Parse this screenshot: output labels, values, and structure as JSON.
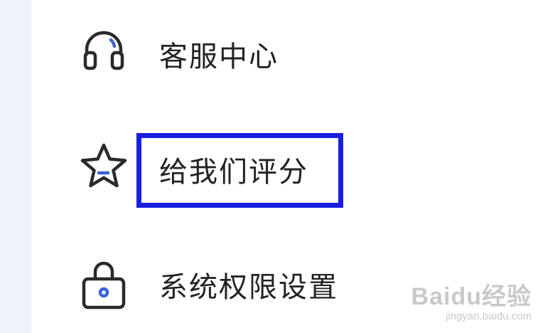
{
  "menu": {
    "items": [
      {
        "label": "客服中心",
        "icon": "headset-icon"
      },
      {
        "label": "给我们评分",
        "icon": "star-icon"
      },
      {
        "label": "系统权限设置",
        "icon": "lock-icon"
      }
    ]
  },
  "watermark": {
    "logo": "Baidu经验",
    "url": "jingyan.baidu.com"
  },
  "colors": {
    "highlight": "#1a1ee0",
    "icon_stroke": "#2a2a2a",
    "icon_accent": "#3d63d8",
    "sidebar_bg": "#eef3fb"
  }
}
